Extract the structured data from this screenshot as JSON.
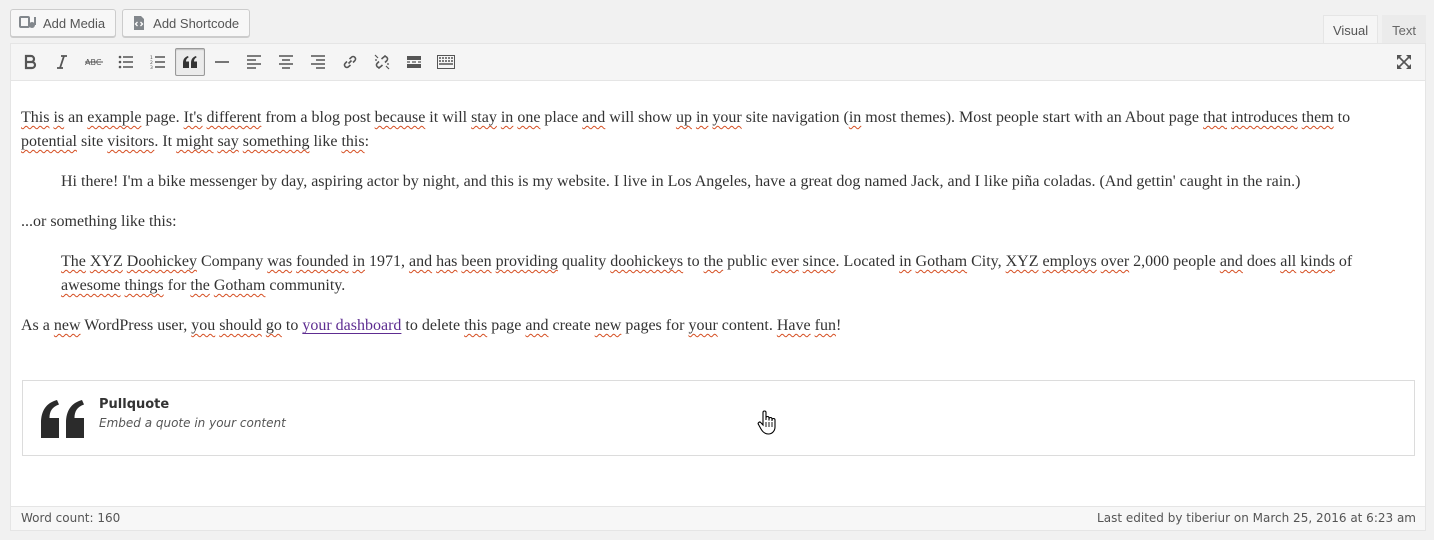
{
  "media_buttons": {
    "add_media": "Add Media",
    "add_shortcode": "Add Shortcode"
  },
  "tabs": [
    {
      "label": "Visual",
      "active": true
    },
    {
      "label": "Text",
      "active": false
    }
  ],
  "toolbar": {
    "icons": [
      "bold-icon",
      "italic-icon",
      "strikethrough-icon",
      "bulleted-list-icon",
      "numbered-list-icon",
      "blockquote-icon",
      "horizontal-line-icon",
      "align-left-icon",
      "align-center-icon",
      "align-right-icon",
      "insert-link-icon",
      "remove-link-icon",
      "read-more-icon",
      "toolbar-toggle-icon",
      "fullscreen-icon"
    ],
    "active": "blockquote-icon"
  },
  "content": {
    "p1": {
      "w1": "This",
      "t1": " ",
      "w2": "is",
      "t2": " an ",
      "w3": "example",
      "t3": " page. ",
      "w4": "It's",
      "t4": " ",
      "w5": "different",
      "t5": " from a blog post ",
      "w6": "because",
      "t6": " it will ",
      "w7": "stay",
      "t7": " ",
      "w8": "in",
      "t8": " ",
      "w9": "one",
      "t9": " place ",
      "w10": "and",
      "t10": " will show ",
      "w11": "up",
      "t11": " ",
      "w12": "in",
      "t12": " ",
      "w13": "your",
      "t13": " site navigation (",
      "w14": "in",
      "t14": " most themes). Most people start with an About page ",
      "w15": "that",
      "t15": " ",
      "w16": "introduces",
      "t16": " ",
      "w17": "them",
      "t17": " to ",
      "w18": "potential",
      "t18": " site ",
      "w19": "visitors",
      "t19": ". It ",
      "w20": "might",
      "t20": " ",
      "w21": "say",
      "t21": " ",
      "w22": "something",
      "t22": " like ",
      "w23": "this",
      "t23": ":"
    },
    "quote1": "Hi there! I'm a bike messenger by day, aspiring actor by night, and this is my website. I live in Los Angeles, have a great dog named Jack, and I like piña coladas. (And gettin' caught in the rain.)",
    "p2": "...or something like this:",
    "quote2": {
      "w1": "The",
      "t1": " ",
      "w2": "XYZ",
      "t2": " ",
      "w3": "Doohickey",
      "t3": " Company ",
      "w4": "was",
      "t4": " ",
      "w5": "founded",
      "t5": " ",
      "w6": "in",
      "t6": " 1971, ",
      "w7": "and",
      "t7": " ",
      "w8": "has",
      "t8": " ",
      "w9": "been",
      "t9": " ",
      "w10": "providing",
      "t10": " quality ",
      "w11": "doohickeys",
      "t11": " to ",
      "w12": "the",
      "t12": " public ",
      "w13": "ever",
      "t13": " ",
      "w14": "since",
      "t14": ". Located ",
      "w15": "in",
      "t15": " ",
      "w16": "Gotham",
      "t16": " City, ",
      "w17": "XYZ",
      "t17": " ",
      "w18": "employs",
      "t18": " ",
      "w19": "over",
      "t19": " 2,000 people ",
      "w20": "and",
      "t20": " does ",
      "w21": "all",
      "t21": " ",
      "w22": "kinds",
      "t22": " of ",
      "w23": "awesome",
      "t23": " ",
      "w24": "things",
      "t24": " for ",
      "w25": "the",
      "t25": " ",
      "w26": "Gotham",
      "t26": " community."
    },
    "p3": {
      "t0": "As a ",
      "w1": "new",
      "t1": " WordPress user, ",
      "w2": "you",
      "t2": " ",
      "w3": "should",
      "t3": " ",
      "w4": "go",
      "t4": " to ",
      "link": "your dashboard",
      "t5": " to delete ",
      "w5": "this",
      "t6": " page ",
      "w6": "and",
      "t7": " create ",
      "w7": "new",
      "t8": " pages for ",
      "w8": "your",
      "t9": " content. ",
      "w9": "Have",
      "t10": " ",
      "w10": "fun",
      "t11": "!"
    }
  },
  "pullquote": {
    "title": "Pullquote",
    "description": "Embed a quote in your content"
  },
  "status": {
    "word_count": "Word count: 160",
    "last_edited": "Last edited by tiberiur on March 25, 2016 at 6:23 am"
  }
}
